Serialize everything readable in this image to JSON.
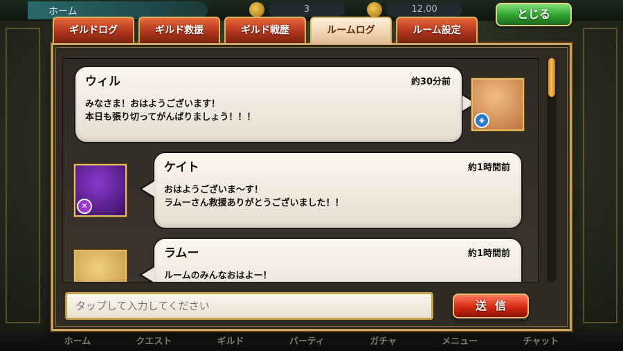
{
  "background": {
    "home_label": "ホーム",
    "stat_1": "3",
    "stat_2": "12,00",
    "nav": [
      "ホーム",
      "クエスト",
      "ギルド",
      "パーティ",
      "ガチャ",
      "メニュー",
      "チャット"
    ]
  },
  "tabs": [
    {
      "label": "ギルドログ",
      "active": false
    },
    {
      "label": "ギルド救援",
      "active": false
    },
    {
      "label": "ギルド戦歴",
      "active": false
    },
    {
      "label": "ルームログ",
      "active": true
    },
    {
      "label": "ルーム設定",
      "active": false
    }
  ],
  "close_label": "とじる",
  "messages": [
    {
      "name": "ウィル",
      "time": "約30分前",
      "text": "みなさま！おはようございます！\n本日も張り切ってがんばりましょう！！！",
      "side": "right",
      "badge_icon": "water-element-icon",
      "avatar_colors": [
        "#f0c080",
        "#c07040"
      ],
      "badge_color": "#2a7ad0"
    },
    {
      "name": "ケイト",
      "time": "約1時間前",
      "text": "おはようございま～す！\nラムーさん救援ありがとうございました！！",
      "side": "left",
      "badge_icon": "sword-element-icon",
      "avatar_colors": [
        "#8a3ad0",
        "#3a1060"
      ],
      "badge_color": "#9a3ad0"
    },
    {
      "name": "ラムー",
      "time": "約1時間前",
      "text": "ルームのみんなおはよー！",
      "side": "left",
      "badge_icon": "",
      "avatar_colors": [
        "#f0d080",
        "#c09040"
      ],
      "badge_color": ""
    }
  ],
  "input": {
    "placeholder": "タップして入力してください"
  },
  "send_label": "送信"
}
